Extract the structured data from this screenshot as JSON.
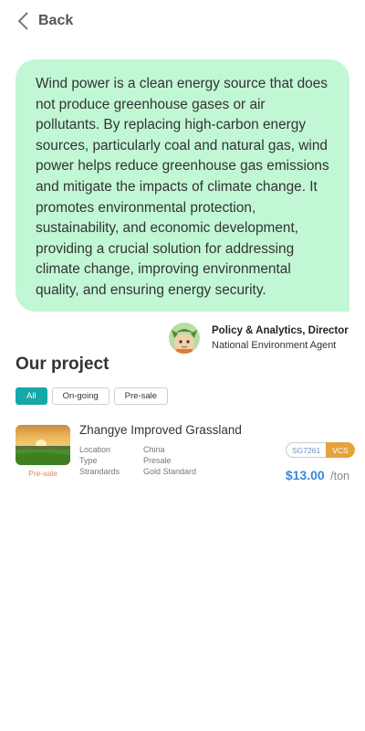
{
  "nav": {
    "back_label": "Back",
    "back_icon": "chevron-left-icon"
  },
  "quote": {
    "text": "Wind power is a clean energy source that does not produce greenhouse gases or air pollutants. By replacing high-carbon energy sources, particularly coal and natural gas, wind power helps reduce greenhouse gas emissions and mitigate the impacts of climate change. It promotes environmental protection, sustainability, and economic development, providing a crucial solution for addressing climate change, improving environmental quality, and ensuring energy security.",
    "background": "#c2f7d6"
  },
  "author": {
    "title": "Policy & Analytics, Director",
    "org": "National Environment Agent"
  },
  "projects_section": {
    "title": "Our project",
    "filters": [
      {
        "label": "All",
        "active": true
      },
      {
        "label": "On-going",
        "active": false
      },
      {
        "label": "Pre-sale",
        "active": false
      }
    ],
    "accent": "#15a8a8"
  },
  "project": {
    "name": "Zhangye Improved Grassland",
    "status_badge": "Pre-sale",
    "specs": [
      {
        "key": "Location",
        "value": "China"
      },
      {
        "key": "Type",
        "value": "Presale"
      },
      {
        "key": "Strandards",
        "value": "Gold Standard"
      }
    ],
    "id_badge": "SG7261",
    "standard_badge": "VCS",
    "price": "$13.00",
    "unit": "/ton",
    "price_color": "#3a87d8",
    "badge_color": "#e6a23c"
  }
}
